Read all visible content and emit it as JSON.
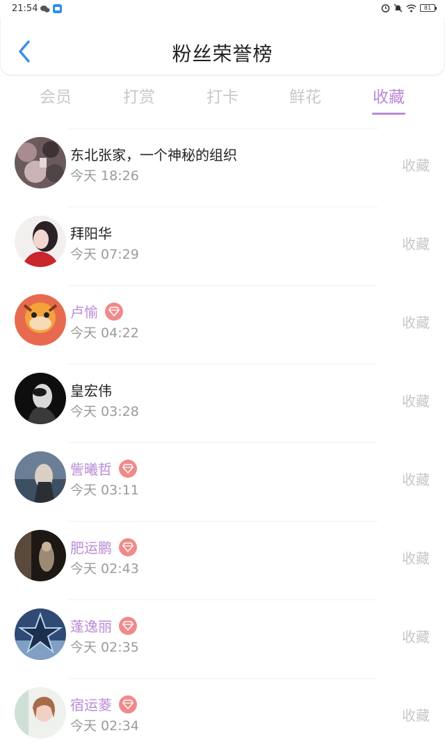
{
  "status_bar": {
    "time": "21:54",
    "battery": "81",
    "left_icons": [
      "chat-bubble-icon",
      "app-icon"
    ],
    "right_icons": [
      "alarm-icon",
      "mute-icon",
      "wifi-icon",
      "battery-icon"
    ]
  },
  "header": {
    "title": "粉丝荣誉榜",
    "back_icon": "chevron-left-icon"
  },
  "tabs": [
    {
      "label": "会员",
      "active": false
    },
    {
      "label": "打赏",
      "active": false
    },
    {
      "label": "打卡",
      "active": false
    },
    {
      "label": "鲜花",
      "active": false
    },
    {
      "label": "收藏",
      "active": true
    }
  ],
  "colors": {
    "accent": "#b98ad6",
    "badge": "#f08a8a",
    "muted": "#c8c8c8",
    "back": "#3a8ee6"
  },
  "list": [
    {
      "name": "东北张家，一个神秘的组织",
      "time": "今天 18:26",
      "vip": false,
      "action": "收藏"
    },
    {
      "name": "拜阳华",
      "time": "今天 07:29",
      "vip": false,
      "action": "收藏"
    },
    {
      "name": "卢愉",
      "time": "今天 04:22",
      "vip": true,
      "action": "收藏"
    },
    {
      "name": "皇宏伟",
      "time": "今天 03:28",
      "vip": false,
      "action": "收藏"
    },
    {
      "name": "訾曦哲",
      "time": "今天 03:11",
      "vip": true,
      "action": "收藏"
    },
    {
      "name": "肥运鹏",
      "time": "今天 02:43",
      "vip": true,
      "action": "收藏"
    },
    {
      "name": "蓬逸丽",
      "time": "今天 02:35",
      "vip": true,
      "action": "收藏"
    },
    {
      "name": "宿运菱",
      "time": "今天 02:34",
      "vip": true,
      "action": "收藏"
    }
  ]
}
